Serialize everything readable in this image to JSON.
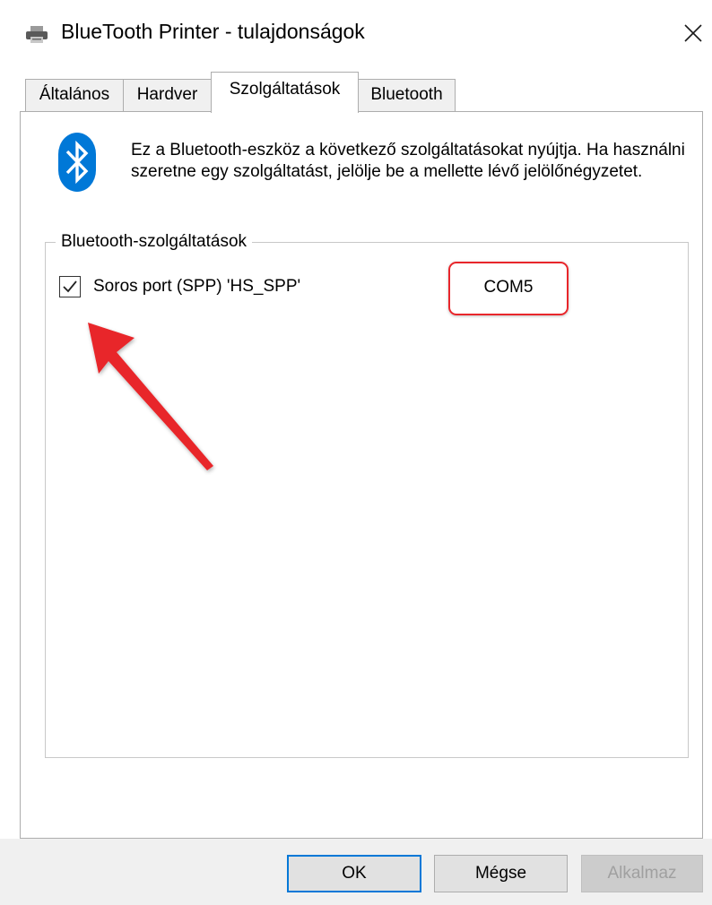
{
  "window": {
    "title": "BlueTooth Printer - tulajdonságok",
    "icon": "printer-icon",
    "close_icon": "close-icon"
  },
  "tabs": [
    {
      "label": "Általános",
      "active": false
    },
    {
      "label": "Hardver",
      "active": false
    },
    {
      "label": "Szolgáltatások",
      "active": true
    },
    {
      "label": "Bluetooth",
      "active": false
    }
  ],
  "services_page": {
    "icon": "bluetooth-icon",
    "intro_text": "Ez a Bluetooth-eszköz a következő szolgáltatásokat nyújtja. Ha használni szeretne egy szolgáltatást, jelölje be a mellette lévő jelölőnégyzetet.",
    "group_label": "Bluetooth-szolgáltatások",
    "services": [
      {
        "label": "Soros port (SPP) 'HS_SPP'",
        "checked": true,
        "port": "COM5"
      }
    ],
    "annotation": {
      "highlight_color": "#e8262b",
      "arrow_color": "#e8262b"
    }
  },
  "buttons": {
    "ok": "OK",
    "cancel": "Mégse",
    "apply": "Alkalmaz",
    "apply_enabled": false
  },
  "colors": {
    "accent": "#0078d7",
    "bluetooth_blue": "#0078d7",
    "annotation_red": "#e8262b"
  }
}
